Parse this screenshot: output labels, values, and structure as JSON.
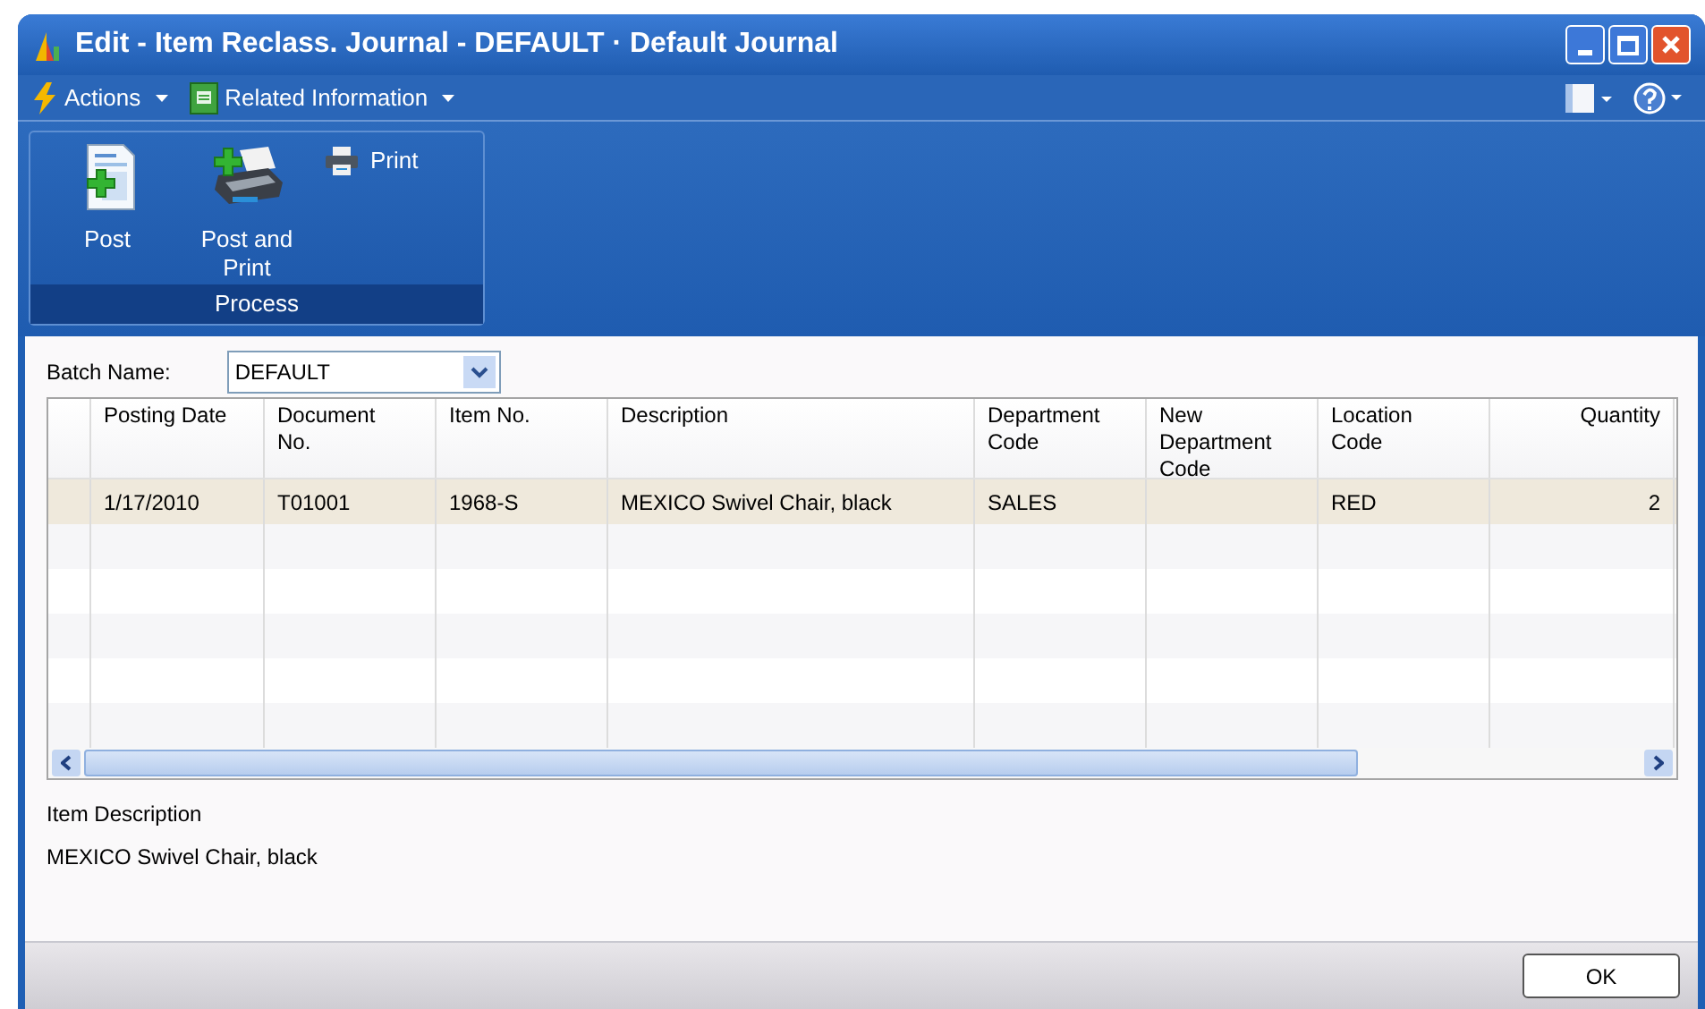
{
  "window": {
    "title": "Edit - Item Reclass. Journal - DEFAULT · Default Journal"
  },
  "menu": [
    {
      "label": "Actions",
      "kind": "actions"
    },
    {
      "label": "Related Information",
      "kind": "related"
    }
  ],
  "ribbon": {
    "group": "Process",
    "large_buttons": [
      {
        "label": "Post",
        "kind": "post"
      },
      {
        "label": "Post and Print",
        "kind": "post-print"
      }
    ],
    "small_buttons": [
      {
        "label": "Print",
        "kind": "print"
      }
    ]
  },
  "batch": {
    "label": "Batch Name:",
    "value": "DEFAULT"
  },
  "table": {
    "columns": [
      {
        "label": "Posting Date",
        "numeric": false
      },
      {
        "label": "Document No.",
        "numeric": false
      },
      {
        "label": "Item No.",
        "numeric": false
      },
      {
        "label": "Description",
        "numeric": false
      },
      {
        "label": "Department Code",
        "numeric": false
      },
      {
        "label": "New Department Code",
        "numeric": false
      },
      {
        "label": "Location Code",
        "numeric": false
      },
      {
        "label": "Quantity",
        "numeric": true
      }
    ],
    "rows": [
      {
        "selected": true,
        "cells": [
          "1/17/2010",
          "T01001",
          "1968-S",
          "MEXICO Swivel Chair, black",
          "SALES",
          "",
          "RED",
          "2"
        ]
      }
    ]
  },
  "details": {
    "label": "Item Description",
    "value": "MEXICO Swivel Chair, black"
  },
  "footer": {
    "ok": "OK"
  }
}
